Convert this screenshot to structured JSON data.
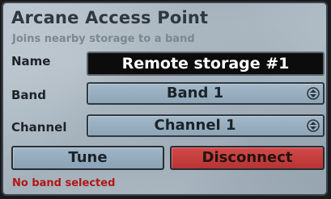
{
  "window": {
    "title": "Arcane Access Point",
    "subtitle": "Joins nearby storage to a band"
  },
  "fields": {
    "name_label": "Name",
    "name_value": "Remote storage #1",
    "band_label": "Band",
    "band_value": "Band 1",
    "channel_label": "Channel",
    "channel_value": "Channel 1"
  },
  "icons": {
    "band_dropdown": "updown-arrows-icon",
    "channel_dropdown": "updown-arrows-icon"
  },
  "buttons": {
    "tune_label": "Tune",
    "disconnect_label": "Disconnect"
  },
  "status": {
    "text": "No band selected"
  },
  "colors": {
    "status_error": "#b31515",
    "disconnect_bg": "#c03b3b",
    "select_bg": "#98aec0"
  }
}
